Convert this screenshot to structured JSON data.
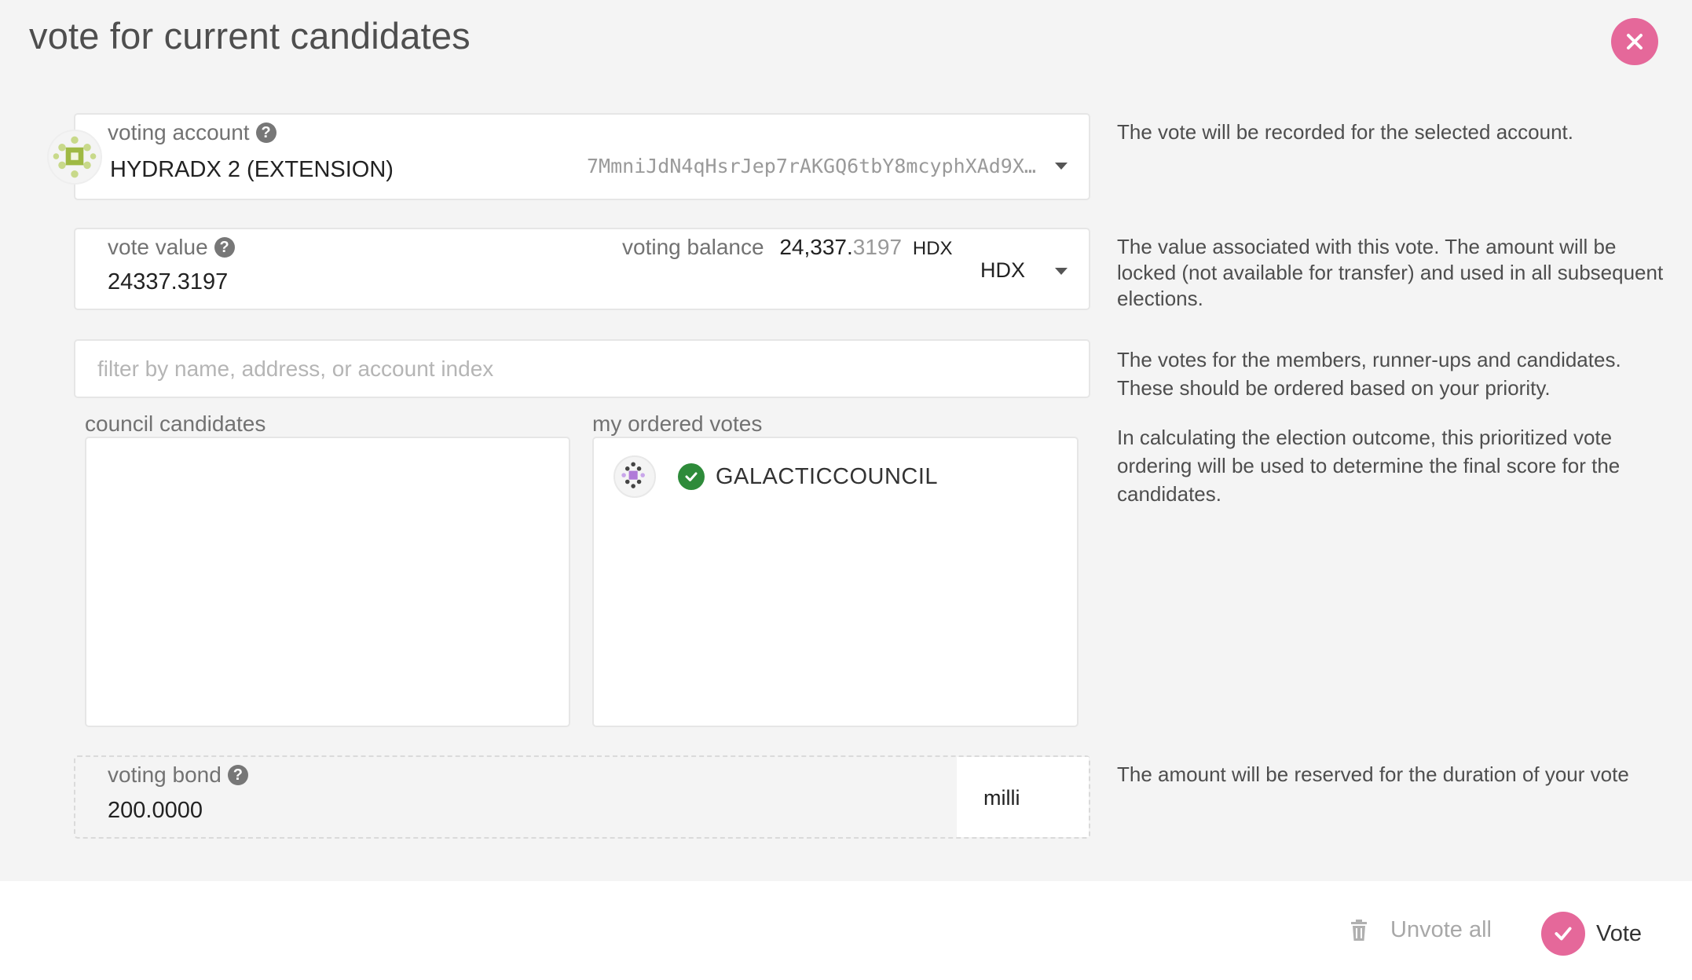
{
  "title": "vote for current candidates",
  "close_icon": "close-icon",
  "colors": {
    "accent": "#e5689a",
    "check": "#2e8b3a"
  },
  "account": {
    "label": "voting account",
    "name": "HYDRADX 2 (EXTENSION)",
    "address": "7MmniJdN4qHsrJep7rAKGQ6tbY8mcyphXAd9X…",
    "help": "The vote will be recorded for the selected account."
  },
  "vote_value": {
    "label": "vote value",
    "value": "24337.3197",
    "balance_label": "voting balance",
    "balance_int": "24,337.",
    "balance_dec": "3197",
    "balance_unit": "HDX",
    "unit": "HDX",
    "help": "The value associated with this vote. The amount will be locked (not available for transfer) and used in all subsequent elections."
  },
  "filter": {
    "placeholder": "filter by name, address, or account index",
    "help": "The votes for the members, runner-ups and candidates. These should be ordered based on your priority."
  },
  "lists": {
    "candidates_label": "council candidates",
    "votes_label": "my ordered votes",
    "votes": [
      {
        "name": "GALACTICCOUNCIL"
      }
    ],
    "help": "In calculating the election outcome, this prioritized vote ordering will be used to determine the final score for the candidates."
  },
  "bond": {
    "label": "voting bond",
    "value": "200.0000",
    "unit": "milli",
    "help": "The amount will be reserved for the duration of your vote"
  },
  "footer": {
    "unvote_label": "Unvote all",
    "vote_label": "Vote"
  }
}
